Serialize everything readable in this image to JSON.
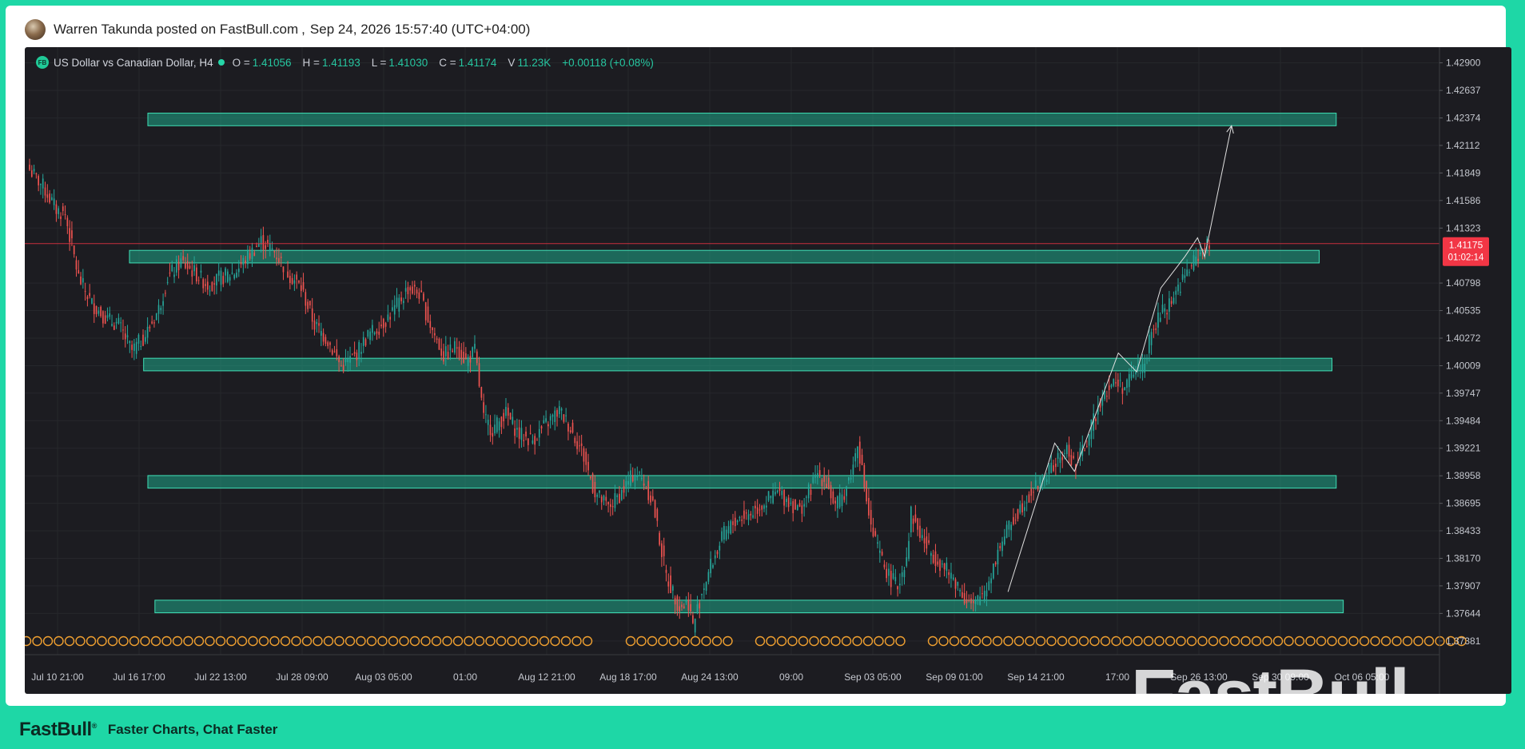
{
  "post": {
    "author_line": "Warren Takunda posted on FastBull.com",
    "separator": ",",
    "timestamp": "Sep 24, 2026 15:57:40 (UTC+04:00)"
  },
  "legend": {
    "badge": "FB",
    "symbol": "US Dollar vs Canadian Dollar, H4",
    "o_label": "O =",
    "o_value": "1.41056",
    "h_label": "H =",
    "h_value": "1.41193",
    "l_label": "L =",
    "l_value": "1.41030",
    "c_label": "C =",
    "c_value": "1.41174",
    "v_label": "V",
    "v_value": "11.23K",
    "change": "+0.00118 (+0.08%)"
  },
  "footer": {
    "logo": "FastBull",
    "tagline": "Faster Charts, Chat Faster"
  },
  "watermark": "FastBull",
  "chart_data": {
    "type": "candlestick",
    "title": "",
    "xlabel": "",
    "ylabel": "",
    "ylim": [
      1.3725,
      1.4305
    ],
    "y_ticks": [
      "1.42900",
      "1.42637",
      "1.42374",
      "1.42112",
      "1.41849",
      "1.41586",
      "1.41323",
      "1.40798",
      "1.40535",
      "1.40272",
      "1.40009",
      "1.39747",
      "1.39484",
      "1.39221",
      "1.38958",
      "1.38695",
      "1.38433",
      "1.38170",
      "1.37907",
      "1.37644",
      "1.37381"
    ],
    "x_ticks": [
      "Jul 10 21:00",
      "Jul 16 17:00",
      "Jul 22 13:00",
      "Jul 28 09:00",
      "Aug 03 05:00",
      "01:00",
      "Aug 12 21:00",
      "Aug 18 17:00",
      "Aug 24 13:00",
      "09:00",
      "Sep 03 05:00",
      "Sep 09 01:00",
      "Sep 14 21:00",
      "17:00",
      "Sep 26 13:00",
      "Sep 30 09:00",
      "Oct 06 05:00"
    ],
    "last_price": "1.41175",
    "countdown": "01:02:14",
    "colors": {
      "up": "#26a69a",
      "down": "#ef5350",
      "zone": "#1fa88a",
      "price_line": "#f23645",
      "background": "#1c1c21"
    },
    "close_anchors": [
      [
        0,
        1.4188
      ],
      [
        6,
        1.4172
      ],
      [
        12,
        1.415
      ],
      [
        16,
        1.4145
      ],
      [
        22,
        1.4085
      ],
      [
        28,
        1.406
      ],
      [
        35,
        1.4045
      ],
      [
        40,
        1.404
      ],
      [
        46,
        1.4015
      ],
      [
        52,
        1.403
      ],
      [
        58,
        1.4055
      ],
      [
        62,
        1.4085
      ],
      [
        68,
        1.41
      ],
      [
        74,
        1.409
      ],
      [
        80,
        1.4078
      ],
      [
        86,
        1.4085
      ],
      [
        92,
        1.409
      ],
      [
        98,
        1.4105
      ],
      [
        104,
        1.412
      ],
      [
        110,
        1.411
      ],
      [
        116,
        1.409
      ],
      [
        122,
        1.4075
      ],
      [
        128,
        1.404
      ],
      [
        134,
        1.4025
      ],
      [
        140,
        1.4
      ],
      [
        146,
        1.401
      ],
      [
        152,
        1.403
      ],
      [
        158,
        1.404
      ],
      [
        164,
        1.4055
      ],
      [
        170,
        1.4075
      ],
      [
        175,
        1.407
      ],
      [
        180,
        1.404
      ],
      [
        186,
        1.401
      ],
      [
        192,
        1.402
      ],
      [
        196,
        1.4005
      ],
      [
        200,
        1.4015
      ],
      [
        204,
        1.395
      ],
      [
        208,
        1.394
      ],
      [
        214,
        1.3955
      ],
      [
        220,
        1.3935
      ],
      [
        226,
        1.393
      ],
      [
        232,
        1.3945
      ],
      [
        238,
        1.3958
      ],
      [
        242,
        1.3945
      ],
      [
        248,
        1.392
      ],
      [
        254,
        1.388
      ],
      [
        260,
        1.3865
      ],
      [
        266,
        1.388
      ],
      [
        272,
        1.39
      ],
      [
        276,
        1.389
      ],
      [
        280,
        1.387
      ],
      [
        286,
        1.38
      ],
      [
        292,
        1.377
      ],
      [
        296,
        1.3775
      ],
      [
        298,
        1.3752
      ],
      [
        302,
        1.3785
      ],
      [
        306,
        1.381
      ],
      [
        312,
        1.384
      ],
      [
        318,
        1.3855
      ],
      [
        324,
        1.386
      ],
      [
        330,
        1.387
      ],
      [
        336,
        1.388
      ],
      [
        342,
        1.387
      ],
      [
        346,
        1.3862
      ],
      [
        350,
        1.388
      ],
      [
        354,
        1.3898
      ],
      [
        358,
        1.389
      ],
      [
        362,
        1.3865
      ],
      [
        366,
        1.388
      ],
      [
        370,
        1.3905
      ],
      [
        372,
        1.393
      ],
      [
        374,
        1.39
      ],
      [
        378,
        1.3845
      ],
      [
        382,
        1.382
      ],
      [
        386,
        1.38
      ],
      [
        390,
        1.379
      ],
      [
        394,
        1.382
      ],
      [
        396,
        1.386
      ],
      [
        400,
        1.384
      ],
      [
        404,
        1.3825
      ],
      [
        410,
        1.381
      ],
      [
        416,
        1.3795
      ],
      [
        420,
        1.378
      ],
      [
        424,
        1.377
      ],
      [
        430,
        1.379
      ],
      [
        436,
        1.383
      ],
      [
        442,
        1.3855
      ],
      [
        448,
        1.3875
      ],
      [
        454,
        1.389
      ],
      [
        460,
        1.3905
      ],
      [
        466,
        1.392
      ],
      [
        470,
        1.3905
      ],
      [
        476,
        1.3935
      ],
      [
        482,
        1.3975
      ],
      [
        488,
        1.3985
      ],
      [
        492,
        1.398
      ],
      [
        496,
        1.3995
      ],
      [
        500,
        1.4
      ],
      [
        504,
        1.403
      ],
      [
        508,
        1.405
      ],
      [
        512,
        1.406
      ],
      [
        516,
        1.4075
      ],
      [
        520,
        1.409
      ],
      [
        524,
        1.4103
      ],
      [
        528,
        1.4116
      ],
      [
        530,
        1.4113
      ]
    ],
    "zones": [
      {
        "x0": 0.087,
        "x1": 0.927,
        "y0": 1.423,
        "y1": 1.4242
      },
      {
        "x0": 0.074,
        "x1": 0.915,
        "y0": 1.4099,
        "y1": 1.4111
      },
      {
        "x0": 0.084,
        "x1": 0.924,
        "y0": 1.3996,
        "y1": 1.4008
      },
      {
        "x0": 0.087,
        "x1": 0.927,
        "y0": 1.3884,
        "y1": 1.3896
      },
      {
        "x0": 0.092,
        "x1": 0.932,
        "y0": 1.3765,
        "y1": 1.3777
      }
    ],
    "projection": [
      [
        0.695,
        1.3785
      ],
      [
        0.728,
        1.3927
      ],
      [
        0.742,
        1.39
      ],
      [
        0.773,
        1.4013
      ],
      [
        0.786,
        1.3995
      ],
      [
        0.803,
        1.4075
      ],
      [
        0.82,
        1.4105
      ],
      [
        0.829,
        1.4123
      ],
      [
        0.834,
        1.4105
      ],
      [
        0.853,
        1.423
      ]
    ]
  }
}
